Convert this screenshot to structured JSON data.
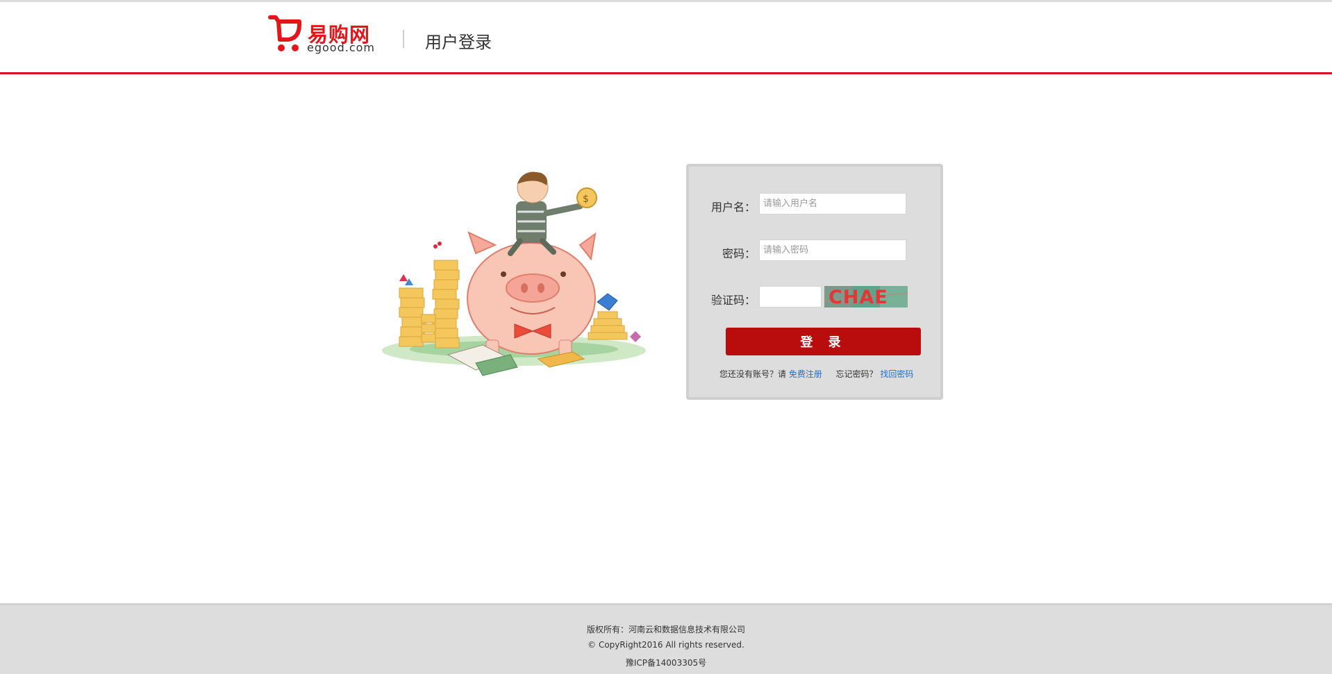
{
  "header": {
    "logo_cn": "易购网",
    "logo_en": "egood.com",
    "title": "用户登录"
  },
  "login": {
    "username_label": "用户名：",
    "username_placeholder": "请输入用户名",
    "password_label": "密码：",
    "password_placeholder": "请输入密码",
    "captcha_label": "验证码：",
    "captcha_text": "CHAE",
    "submit_label": "登 录",
    "no_account_text": "您还没有账号？请",
    "register_link": "免费注册",
    "forgot_text": "忘记密码？",
    "recover_link": "找回密码"
  },
  "footer": {
    "copyright_owner": "版权所有：河南云和数据信息技术有限公司",
    "copyright_line": "© CopyRight2016 All rights reserved.",
    "icp": "豫ICP备14003305号"
  },
  "colors": {
    "brand_red": "#e4161b",
    "button_red": "#b90c0c",
    "link_blue": "#1d6fcf",
    "panel_gray": "#dddddd"
  }
}
